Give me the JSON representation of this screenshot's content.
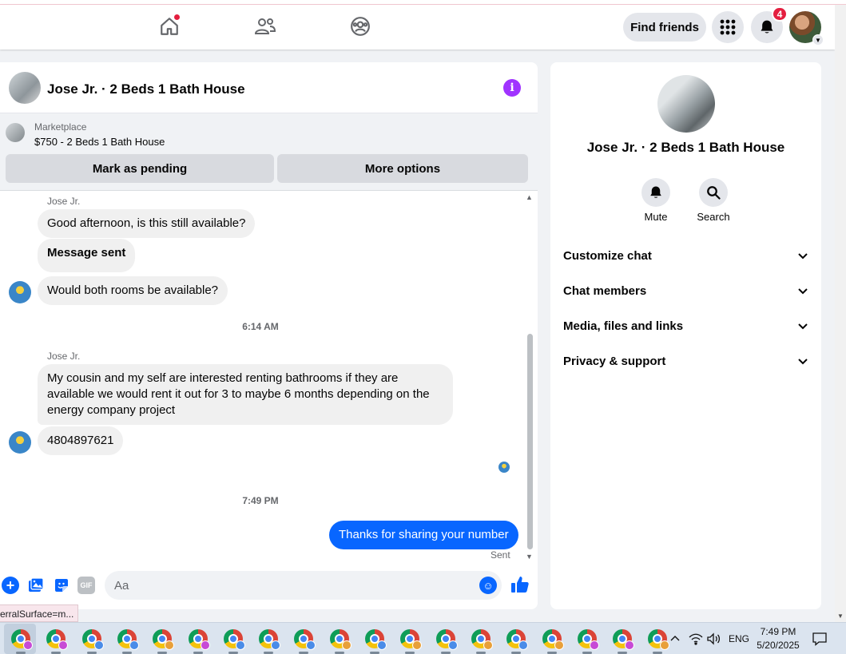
{
  "header": {
    "nav": [
      {
        "name": "home-icon"
      },
      {
        "name": "friends-icon"
      },
      {
        "name": "groups-icon"
      }
    ],
    "find_friends_label": "Find friends",
    "notification_count": "4",
    "colors": {
      "accent": "#0866ff",
      "badge": "#e41e3f",
      "info": "#a033ff"
    }
  },
  "chat": {
    "title": "Jose Jr. · 2 Beds 1 Bath House",
    "marketplace": {
      "label": "Marketplace",
      "listing": "$750 - 2 Beds 1 Bath House",
      "pending_label": "Mark as pending",
      "more_label": "More options"
    },
    "messages": {
      "sender_1": "Jose Jr.",
      "m1": "Good afternoon, is this still available?",
      "m2": "Message sent",
      "m3": "Would both rooms be available?",
      "time_1": "6:14 AM",
      "sender_2": "Jose Jr.",
      "m4": "My cousin and my self are interested renting bathrooms if they are available we would rent it out for 3 to maybe 6 months depending on the energy company project",
      "m5": "4804897621",
      "time_2": "7:49 PM",
      "m6": "Thanks for sharing your number",
      "sent_label": "Sent"
    },
    "composer": {
      "placeholder": "Aa",
      "gif_label": "GIF"
    }
  },
  "info_panel": {
    "name": "Jose Jr. · 2 Beds 1 Bath House",
    "mute_label": "Mute",
    "search_label": "Search",
    "sections": [
      {
        "label": "Customize chat"
      },
      {
        "label": "Chat members"
      },
      {
        "label": "Media, files and links"
      },
      {
        "label": "Privacy & support"
      }
    ]
  },
  "status_tooltip": "erralSurface=m...",
  "taskbar": {
    "language": "ENG",
    "time": "7:49 PM",
    "date": "5/20/2025"
  }
}
